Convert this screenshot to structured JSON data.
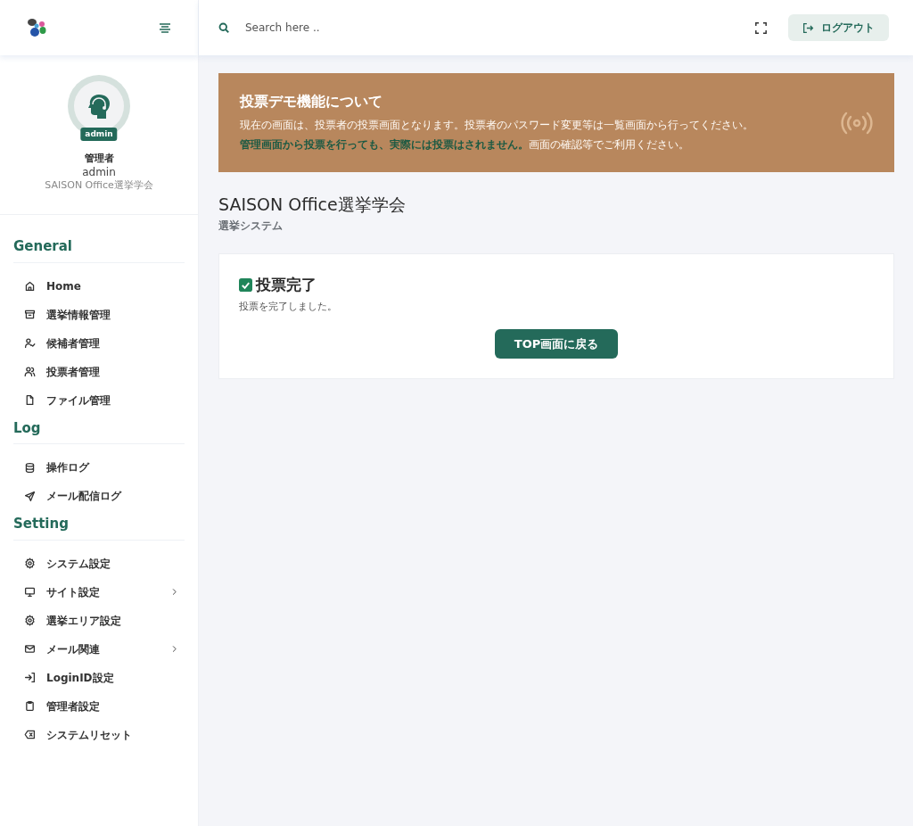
{
  "header": {
    "search": {
      "placeholder": "Search here .."
    },
    "logout_button": "ログアウト"
  },
  "profile": {
    "badge": "admin",
    "role": "管理者",
    "username": "admin",
    "organization": "SAISON Office選挙学会"
  },
  "sidebar": {
    "sections": [
      {
        "title": "General",
        "items": [
          {
            "label": "Home",
            "has_submenu": false
          },
          {
            "label": "選挙情報管理",
            "has_submenu": false
          },
          {
            "label": "候補者管理",
            "has_submenu": false
          },
          {
            "label": "投票者管理",
            "has_submenu": false
          },
          {
            "label": "ファイル管理",
            "has_submenu": false
          }
        ]
      },
      {
        "title": "Log",
        "items": [
          {
            "label": "操作ログ",
            "has_submenu": false
          },
          {
            "label": "メール配信ログ",
            "has_submenu": false
          }
        ]
      },
      {
        "title": "Setting",
        "items": [
          {
            "label": "システム設定",
            "has_submenu": false
          },
          {
            "label": "サイト設定",
            "has_submenu": true
          },
          {
            "label": "選挙エリア設定",
            "has_submenu": false
          },
          {
            "label": "メール関連",
            "has_submenu": true
          },
          {
            "label": "LoginID設定",
            "has_submenu": false
          },
          {
            "label": "管理者設定",
            "has_submenu": false
          },
          {
            "label": "システムリセット",
            "has_submenu": false
          }
        ]
      }
    ]
  },
  "notice": {
    "title": "投票デモ機能について",
    "lines": [
      "現在の画面は、投票者の投票画面となります。投票者のパスワード変更等は一覧画面から行ってください。",
      "**管理画面から投票を行っても、実際には投票はされません。**画面の確認等でご利用ください。"
    ]
  },
  "page": {
    "title": "SAISON Office選挙学会",
    "subtitle": "選挙システム"
  },
  "result_card": {
    "title": "投票完了",
    "checked": true,
    "message": "投票を完了しました。",
    "button": "TOP画面に戻る"
  }
}
